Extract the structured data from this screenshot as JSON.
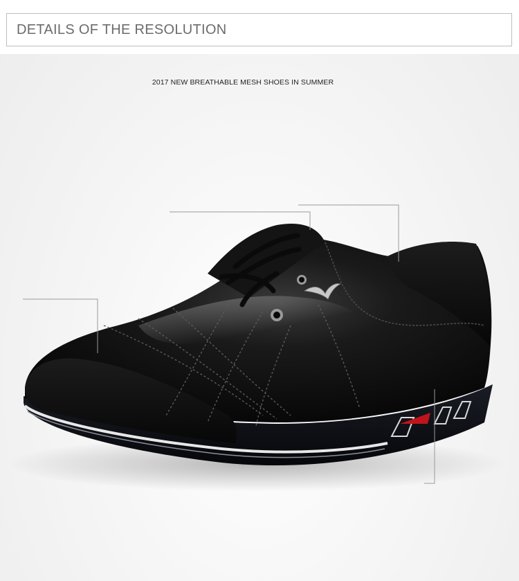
{
  "header": {
    "title": "DETAILS OF THE RESOLUTION"
  },
  "product": {
    "headline": "2017 NEW BREATHABLE MESH SHOES IN SUMMER"
  },
  "colors": {
    "header_text": "#6b6b6b",
    "header_border": "#bdbdbd",
    "shoe_leather": "#0c0c0c",
    "sole_accent_red": "#c0141a",
    "sole_stripe_white": "#e8e8e8"
  }
}
